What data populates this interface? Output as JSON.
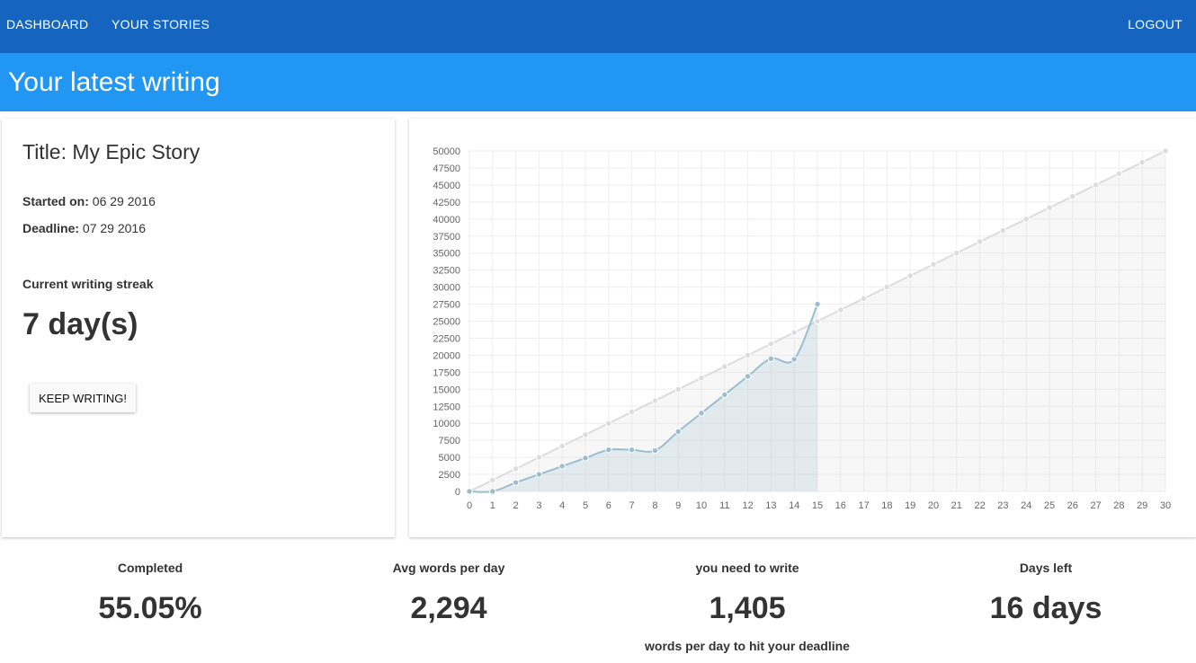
{
  "nav": {
    "dashboard": "DASHBOARD",
    "stories": "YOUR STORIES",
    "logout": "LOGOUT"
  },
  "header": {
    "title": "Your latest writing"
  },
  "story": {
    "title": "Title: My Epic Story",
    "started_label": "Started on:",
    "started_value": "06 29 2016",
    "deadline_label": "Deadline:",
    "deadline_value": "07 29 2016",
    "streak_label": "Current writing streak",
    "streak_value": "7 day(s)",
    "keep_button": "KEEP WRITING!"
  },
  "colors": {
    "nav": "#1565c0",
    "subheader": "#2196f3",
    "actual": "#9bbdd0",
    "target": "#dcdcdc"
  },
  "chart_data": {
    "type": "line",
    "x": [
      0,
      1,
      2,
      3,
      4,
      5,
      6,
      7,
      8,
      9,
      10,
      11,
      12,
      13,
      14,
      15,
      16,
      17,
      18,
      19,
      20,
      21,
      22,
      23,
      24,
      25,
      26,
      27,
      28,
      29,
      30
    ],
    "xlim": [
      0,
      30
    ],
    "ylim": [
      0,
      50000
    ],
    "yticks": [
      0,
      2500,
      5000,
      7500,
      10000,
      12500,
      15000,
      17500,
      20000,
      22500,
      25000,
      27500,
      30000,
      32500,
      35000,
      37500,
      40000,
      42500,
      45000,
      47500,
      50000
    ],
    "grid": true,
    "series": [
      {
        "values": [
          0,
          1667,
          3333,
          5000,
          6667,
          8333,
          10000,
          11667,
          13333,
          15000,
          16667,
          18333,
          20000,
          21667,
          23333,
          25000,
          26667,
          28333,
          30000,
          31667,
          33333,
          35000,
          36667,
          38333,
          40000,
          41667,
          43333,
          45000,
          46667,
          48333,
          50000
        ]
      },
      {
        "values": [
          0,
          0,
          1300,
          2500,
          3700,
          4900,
          6100,
          6100,
          6000,
          8800,
          11500,
          14200,
          16900,
          19500,
          19400,
          27500
        ]
      }
    ]
  },
  "stats": [
    {
      "label": "Completed",
      "value": "55.05%",
      "sub": ""
    },
    {
      "label": "Avg words per day",
      "value": "2,294",
      "sub": ""
    },
    {
      "label": "you need to write",
      "value": "1,405",
      "sub": "words per day to hit your deadline"
    },
    {
      "label": "Days left",
      "value": "16 days",
      "sub": ""
    }
  ]
}
